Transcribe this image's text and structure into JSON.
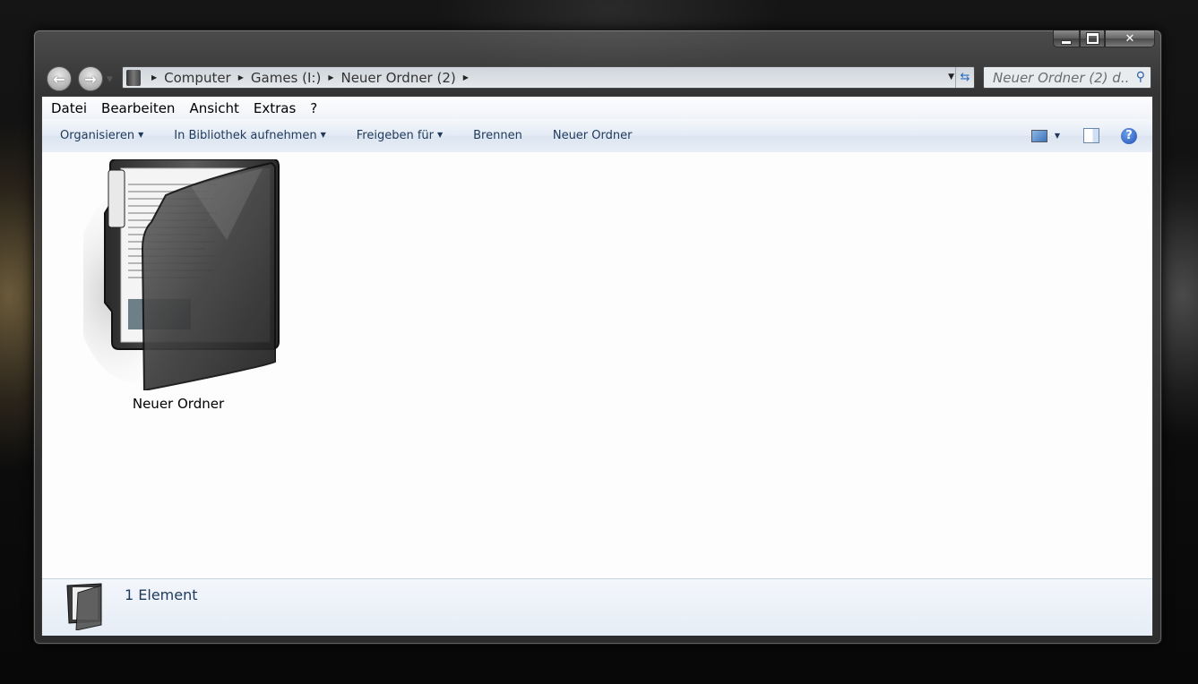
{
  "window": {
    "caption_buttons": {
      "minimize": "minimize",
      "maximize": "maximize",
      "close": "close"
    }
  },
  "nav": {
    "breadcrumbs": [
      "Computer",
      "Games (I:)",
      "Neuer Ordner (2)"
    ],
    "search_placeholder": "Neuer Ordner (2) d..."
  },
  "menubar": {
    "items": [
      "Datei",
      "Bearbeiten",
      "Ansicht",
      "Extras",
      "?"
    ]
  },
  "commandbar": {
    "items": [
      {
        "label": "Organisieren",
        "dropdown": true
      },
      {
        "label": "In Bibliothek aufnehmen",
        "dropdown": true
      },
      {
        "label": "Freigeben für",
        "dropdown": true
      },
      {
        "label": "Brennen",
        "dropdown": false
      },
      {
        "label": "Neuer Ordner",
        "dropdown": false
      }
    ],
    "help_glyph": "?"
  },
  "content": {
    "items": [
      {
        "name": "Neuer Ordner",
        "icon": "folder-icon"
      }
    ]
  },
  "statusbar": {
    "text": "1 Element"
  },
  "colors": {
    "accent_text": "#1e395b",
    "help_blue": "#1f4fb5"
  }
}
